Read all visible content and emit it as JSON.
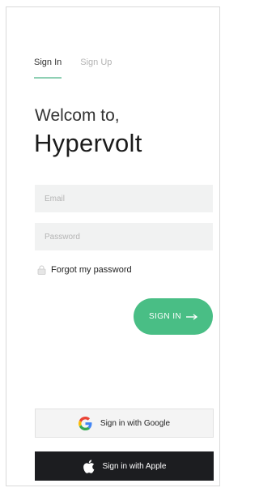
{
  "tabs": [
    {
      "label": "Sign In",
      "active": true
    },
    {
      "label": "Sign Up",
      "active": false
    }
  ],
  "welcome": "Welcom to,",
  "brand": "Hypervolt",
  "email": {
    "placeholder": "Email",
    "value": ""
  },
  "password": {
    "placeholder": "Password",
    "value": ""
  },
  "forgot": {
    "label": "Forgot my password",
    "icon": "lock-icon"
  },
  "signin": {
    "label": "SIGN IN",
    "icon": "arrow-right-icon"
  },
  "google": {
    "label": "Sign in with Google",
    "icon": "google-icon"
  },
  "apple": {
    "label": "Sign in with Apple",
    "icon": "apple-icon"
  },
  "colors": {
    "accent": "#49be85",
    "tab_underline": "#8fd0b4",
    "apple_bg": "#1c1d20",
    "input_bg": "#f1f2f2"
  }
}
